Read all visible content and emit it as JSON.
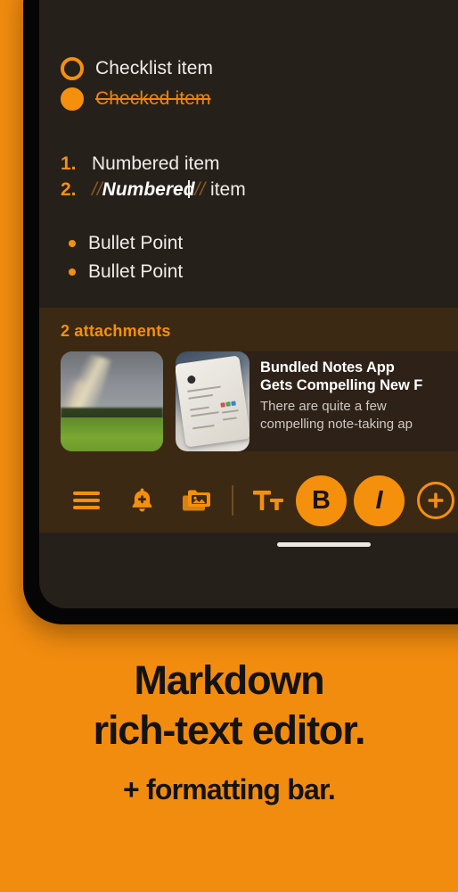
{
  "editor": {
    "checklist": [
      {
        "label": "Checklist item",
        "checked": false
      },
      {
        "label": "Checked item",
        "checked": true
      }
    ],
    "numbered": [
      {
        "marker": "1.",
        "text": "Numbered item",
        "emphasis": ""
      },
      {
        "marker": "2.",
        "text_before_mark": "",
        "mark_open": "//",
        "emphasis": "Numbered",
        "mark_close": "//",
        "text_after": "item"
      }
    ],
    "bullets": [
      {
        "label": "Bullet Point"
      },
      {
        "label": "Bullet Point"
      }
    ]
  },
  "attachments": {
    "title": "2 attachments",
    "photo": {
      "alt": "rainbow-over-field-photo"
    },
    "link_card": {
      "headline_line1": "Bundled Notes App",
      "headline_line2": "Gets Compelling New F",
      "desc_line1": "There are quite a few",
      "desc_line2": "compelling note-taking ap",
      "thumb_alt": "phone-showing-notes-app"
    }
  },
  "toolbar": {
    "items": [
      {
        "name": "menu-icon",
        "label": ""
      },
      {
        "name": "reminder-bell-icon",
        "label": ""
      },
      {
        "name": "image-folder-icon",
        "label": ""
      },
      {
        "name": "text-size-icon",
        "label": "Tt"
      },
      {
        "name": "bold-button",
        "label": "B"
      },
      {
        "name": "italic-button",
        "label": "I"
      },
      {
        "name": "add-button",
        "label": "+"
      }
    ],
    "bold_label": "B",
    "italic_label": "I",
    "text_size_label": "Tt",
    "add_label": "+"
  },
  "promo": {
    "line1": "Markdown",
    "line2": "rich-text editor.",
    "line3": "+ formatting bar."
  },
  "colors": {
    "brand_orange": "#F28C0F",
    "accent_orange": "#F5900C",
    "editor_bg": "#26201B",
    "panel_bg": "#3C2913",
    "device_bezel": "#050505",
    "text_primary": "#F0EDE9",
    "promo_text": "#131313"
  }
}
